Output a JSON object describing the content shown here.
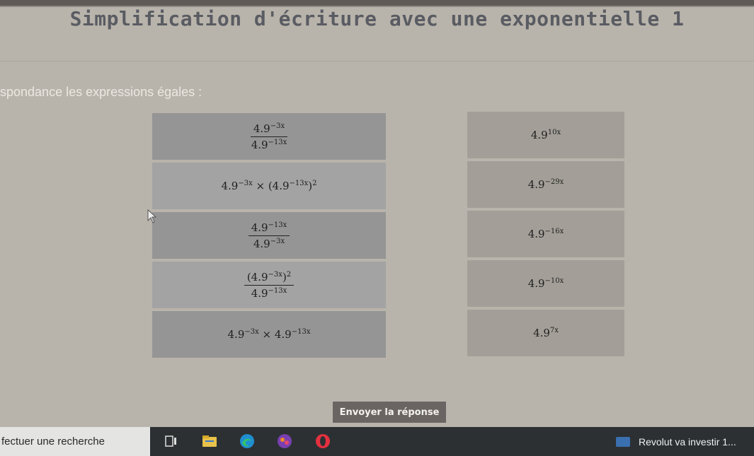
{
  "title": "Simplification d'écriture avec une exponentielle 1",
  "instruction": "spondance les expressions égales :",
  "left_items": [
    {
      "type": "frac",
      "num": "4.9",
      "num_exp": "−3x",
      "den": "4.9",
      "den_exp": "−13x"
    },
    {
      "type": "text",
      "text": "4.9",
      "exp": "−3x",
      "rest": " × (4.9",
      "rest_exp": "−13x",
      "close": ")",
      "close_exp": "2"
    },
    {
      "type": "frac",
      "num": "4.9",
      "num_exp": "−13x",
      "den": "4.9",
      "den_exp": "−3x"
    },
    {
      "type": "frac",
      "num": "(4.9",
      "num_exp": "−3x",
      "num_close": ")",
      "num_close_exp": "2",
      "den": "4.9",
      "den_exp": "−13x"
    },
    {
      "type": "text",
      "text": "4.9",
      "exp": "−3x",
      "rest": " × 4.9",
      "rest_exp": "−13x"
    }
  ],
  "right_items": [
    {
      "base": "4.9",
      "exp": "10x"
    },
    {
      "base": "4.9",
      "exp": "−29x"
    },
    {
      "base": "4.9",
      "exp": "−16x"
    },
    {
      "base": "4.9",
      "exp": "−10x"
    },
    {
      "base": "4.9",
      "exp": "7x"
    }
  ],
  "submit_label": "Envoyer la réponse",
  "taskbar": {
    "search_text": "fectuer une recherche",
    "news_text": "Revolut va investir 1..."
  }
}
